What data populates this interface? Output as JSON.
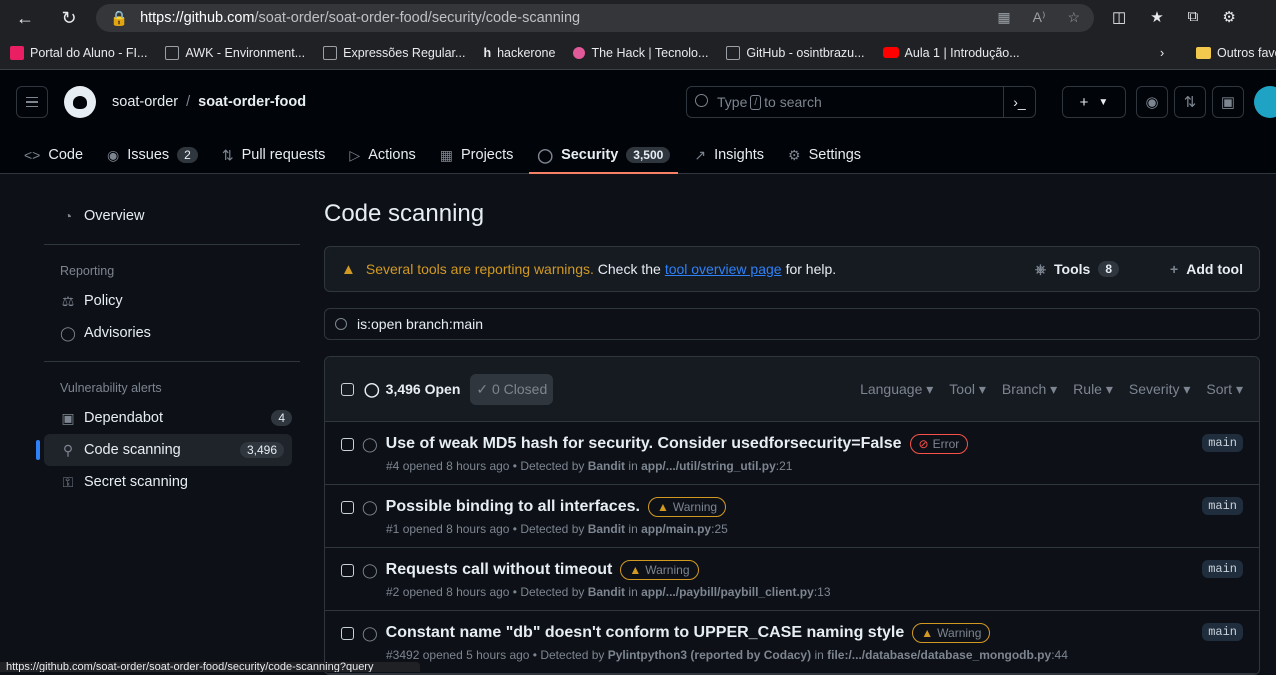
{
  "browser": {
    "url_host": "https://github.com",
    "url_path": "/soat-order/soat-order-food/security/code-scanning",
    "bookmarks": [
      "Portal do Aluno - FI...",
      "AWK - Environment...",
      "Expressões Regular...",
      "hackerone",
      "The Hack | Tecnolo...",
      "GitHub - osintbrazu...",
      "Aula 1 | Introdução..."
    ],
    "other_bookmarks": "Outros favo",
    "status_url": "https://github.com/soat-order/soat-order-food/security/code-scanning?query"
  },
  "header": {
    "owner": "soat-order",
    "separator": "/",
    "repo": "soat-order-food",
    "search_before": "Type",
    "search_key": "/",
    "search_after": "to search",
    "plus": "+"
  },
  "tabs": [
    {
      "label": "Code",
      "count": ""
    },
    {
      "label": "Issues",
      "count": "2"
    },
    {
      "label": "Pull requests",
      "count": ""
    },
    {
      "label": "Actions",
      "count": ""
    },
    {
      "label": "Projects",
      "count": ""
    },
    {
      "label": "Security",
      "count": "3,500"
    },
    {
      "label": "Insights",
      "count": ""
    },
    {
      "label": "Settings",
      "count": ""
    }
  ],
  "sidebar": {
    "overview": "Overview",
    "reporting_heading": "Reporting",
    "policy": "Policy",
    "advisories": "Advisories",
    "vuln_heading": "Vulnerability alerts",
    "dependabot": "Dependabot",
    "dependabot_count": "4",
    "code_scanning": "Code scanning",
    "code_scanning_count": "3,496",
    "secret_scanning": "Secret scanning"
  },
  "main": {
    "title": "Code scanning",
    "flash_warn": "Several tools are reporting warnings.",
    "flash_check": "Check the",
    "flash_link": "tool overview page",
    "flash_help": "for help.",
    "tools_label": "Tools",
    "tools_count": "8",
    "add_tool": "Add tool",
    "filter_value": "is:open branch:main",
    "open_count": "3,496 Open",
    "closed_count": "0 Closed",
    "filters": [
      "Language",
      "Tool",
      "Branch",
      "Rule",
      "Severity",
      "Sort"
    ]
  },
  "alerts": [
    {
      "title": "Use of weak MD5 hash for security. Consider usedforsecurity=False",
      "severity": "Error",
      "num": "#4",
      "opened": "opened 8 hours ago • Detected by",
      "tool": "Bandit",
      "in": "in",
      "path": "app/.../util/string_util.py",
      "line": ":21",
      "branch": "main"
    },
    {
      "title": "Possible binding to all interfaces.",
      "severity": "Warning",
      "num": "#1",
      "opened": "opened 8 hours ago • Detected by",
      "tool": "Bandit",
      "in": "in",
      "path": "app/main.py",
      "line": ":25",
      "branch": "main"
    },
    {
      "title": "Requests call without timeout",
      "severity": "Warning",
      "num": "#2",
      "opened": "opened 8 hours ago • Detected by",
      "tool": "Bandit",
      "in": "in",
      "path": "app/.../paybill/paybill_client.py",
      "line": ":13",
      "branch": "main"
    },
    {
      "title": "Constant name \"db\" doesn't conform to UPPER_CASE naming style",
      "severity": "Warning",
      "num": "#3492",
      "opened": "opened 5 hours ago • Detected by",
      "tool": "Pylintpython3 (reported by Codacy)",
      "in": "in",
      "path": "file:/.../database/database_mongodb.py",
      "line": ":44",
      "branch": "main"
    }
  ]
}
